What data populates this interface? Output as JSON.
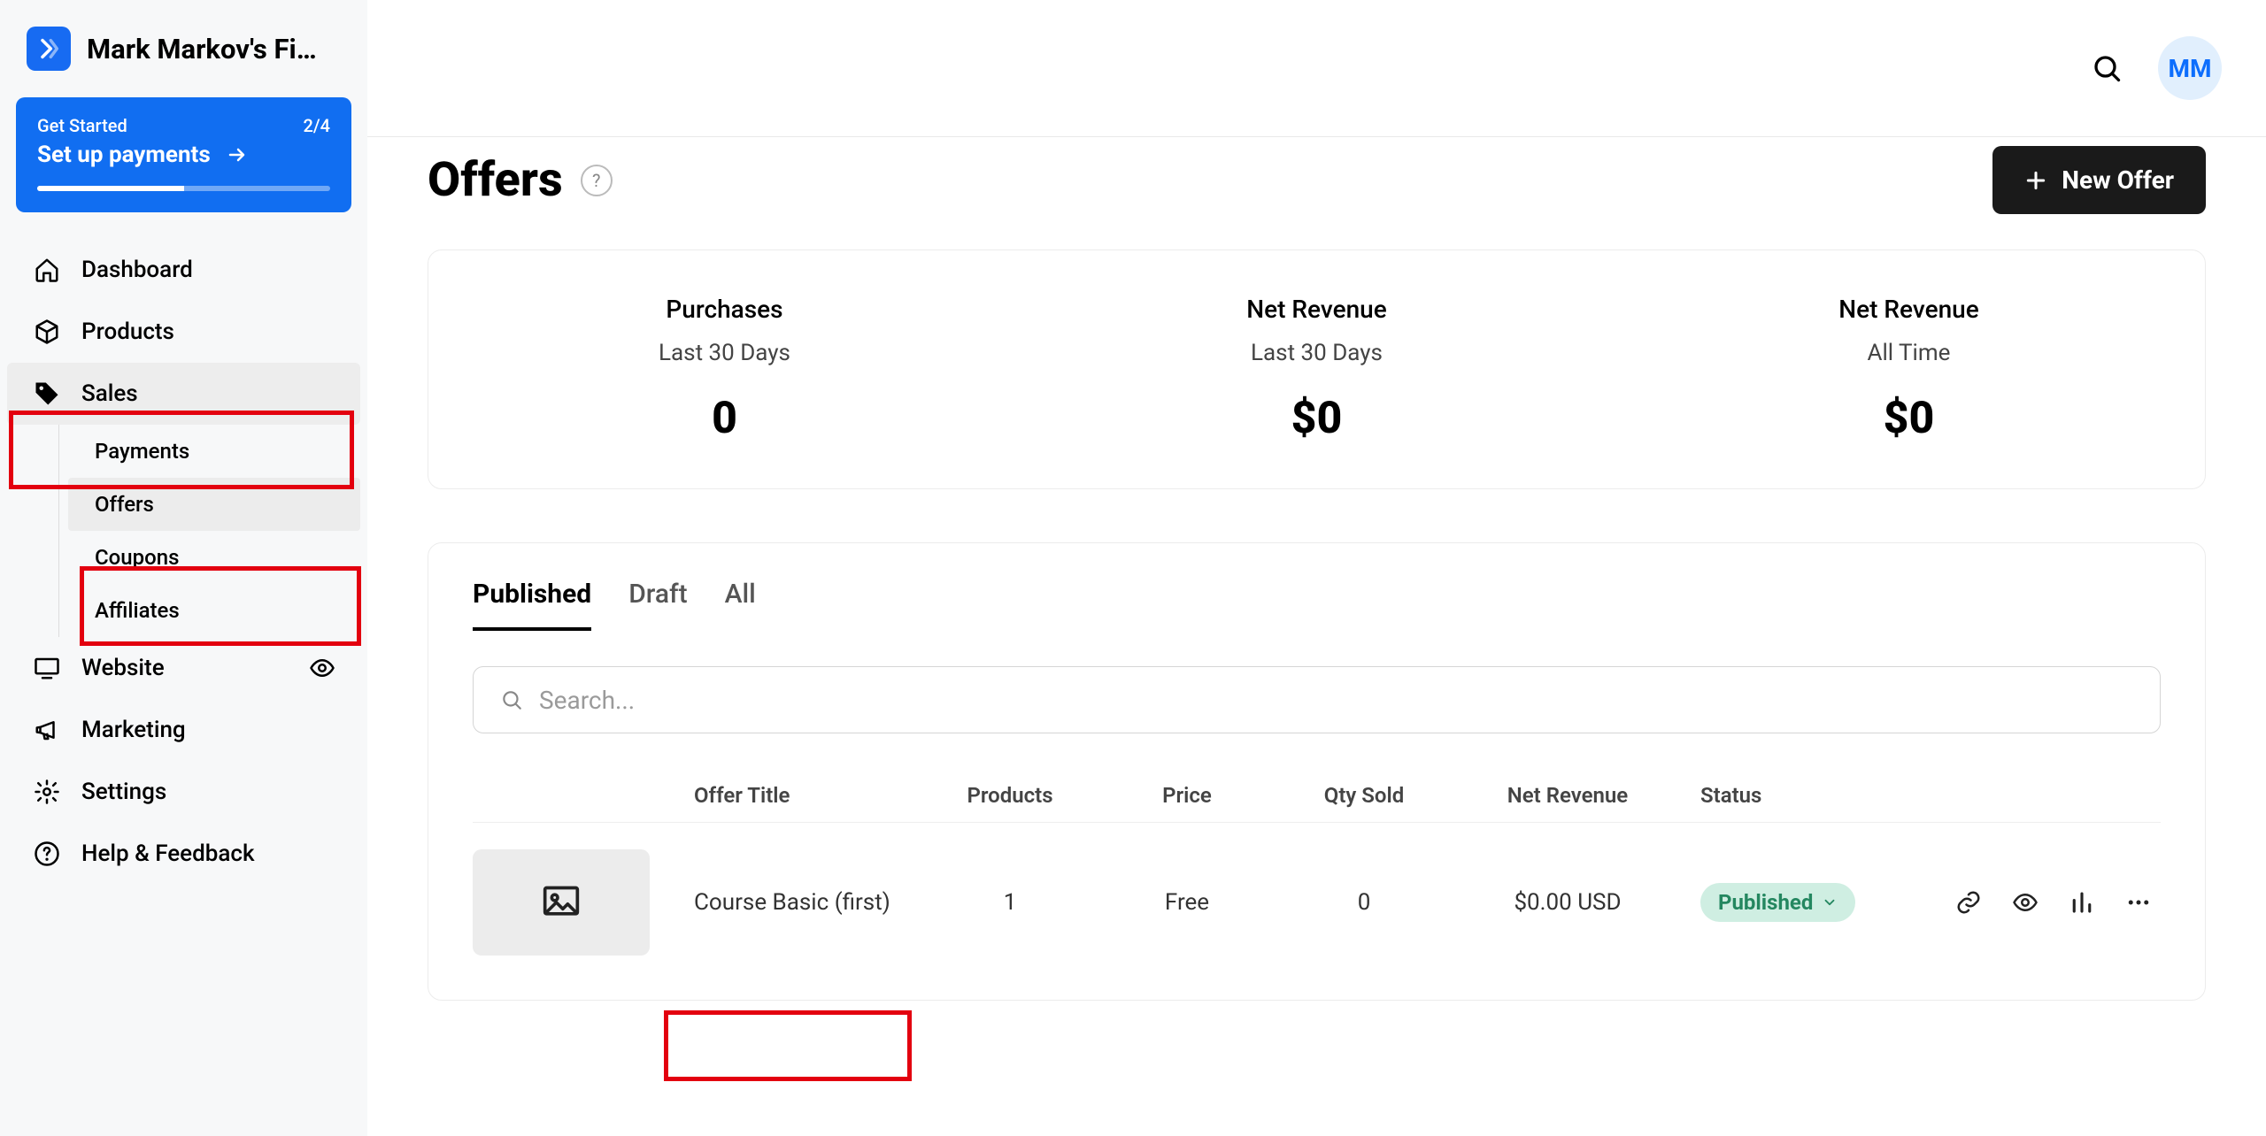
{
  "workspace": {
    "name": "Mark Markov's Fi…"
  },
  "get_started": {
    "label": "Get Started",
    "progress_text": "2/4",
    "action": "Set up payments",
    "progress_percent": 50
  },
  "sidebar": {
    "items": [
      {
        "label": "Dashboard"
      },
      {
        "label": "Products"
      },
      {
        "label": "Sales"
      },
      {
        "label": "Website"
      },
      {
        "label": "Marketing"
      },
      {
        "label": "Settings"
      },
      {
        "label": "Help & Feedback"
      }
    ],
    "sales_sub": [
      {
        "label": "Payments"
      },
      {
        "label": "Offers"
      },
      {
        "label": "Coupons"
      },
      {
        "label": "Affiliates"
      }
    ]
  },
  "user": {
    "initials": "MM"
  },
  "page": {
    "title": "Offers",
    "new_button": "New Offer"
  },
  "stats": [
    {
      "label": "Purchases",
      "sub": "Last 30 Days",
      "value": "0"
    },
    {
      "label": "Net Revenue",
      "sub": "Last 30 Days",
      "value": "$0"
    },
    {
      "label": "Net Revenue",
      "sub": "All Time",
      "value": "$0"
    }
  ],
  "tabs": [
    {
      "label": "Published",
      "active": true
    },
    {
      "label": "Draft",
      "active": false
    },
    {
      "label": "All",
      "active": false
    }
  ],
  "search": {
    "placeholder": "Search..."
  },
  "table": {
    "headers": {
      "title": "Offer Title",
      "products": "Products",
      "price": "Price",
      "qty": "Qty Sold",
      "revenue": "Net Revenue",
      "status": "Status"
    },
    "rows": [
      {
        "title": "Course Basic (first)",
        "products": "1",
        "price": "Free",
        "qty": "0",
        "revenue": "$0.00 USD",
        "status": "Published"
      }
    ]
  }
}
